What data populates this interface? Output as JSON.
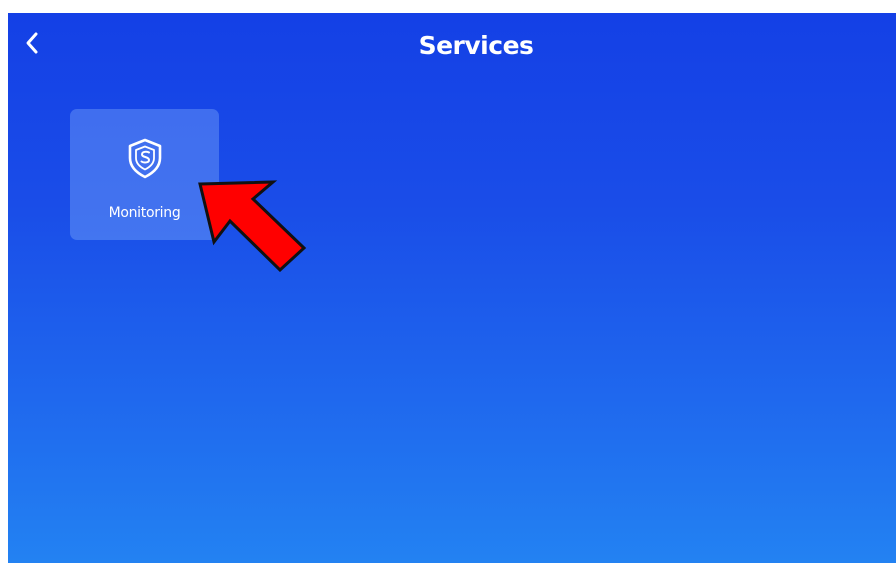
{
  "header": {
    "title": "Services",
    "back_icon": "chevron-left-icon"
  },
  "services": [
    {
      "label": "Monitoring",
      "icon": "shield-s-icon"
    }
  ],
  "annotation": {
    "icon": "red-arrow-pointer"
  },
  "colors": {
    "background_top": "#1440e6",
    "background_bottom": "#2382f2",
    "tile": "#6f95ef",
    "text": "#ffffff",
    "annotation_arrow": "#ff0000"
  }
}
